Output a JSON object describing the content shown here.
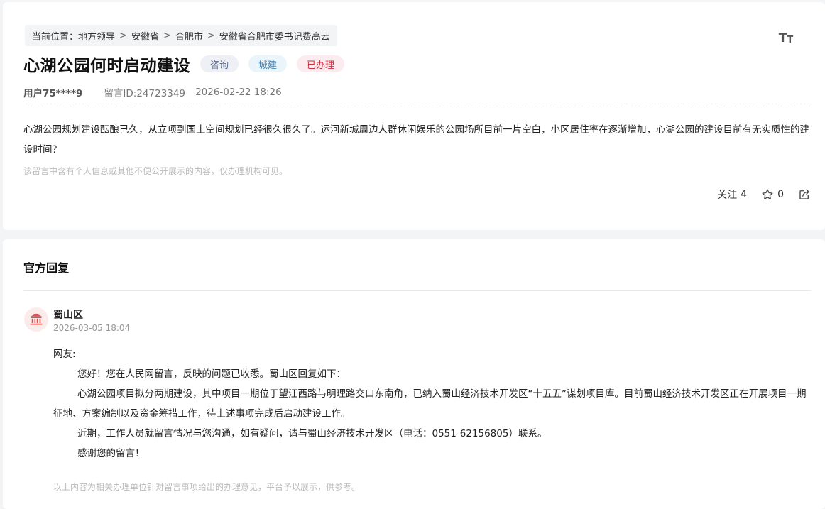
{
  "breadcrumb": {
    "prefix": "当前位置：",
    "items": [
      "地方领导",
      "安徽省",
      "合肥市",
      "安徽省合肥市委书记费高云"
    ],
    "separator": ">"
  },
  "font_size_toggle": {
    "big": "T",
    "small": "T"
  },
  "post": {
    "title": "心湖公园何时启动建设",
    "tags": [
      "咨询",
      "城建",
      "已办理"
    ],
    "user": "用户75****9",
    "message_id": "留言ID:24723349",
    "datetime": "2026-02-22 18:26",
    "content": "心湖公园规划建设酝酿已久，从立项到国土空间规划已经很久很久了。运河新城周边人群休闲娱乐的公园场所目前一片空白，小区居住率在逐渐增加，心湖公园的建设目前有无实质性的建设时间？",
    "privacy_note": "该留言中含有个人信息或其他不便公开展示的内容，仅办理机构可见。",
    "follow_label": "关注",
    "follow_count": "4",
    "star_count": "0"
  },
  "reply": {
    "heading": "官方回复",
    "org_name": "蜀山区",
    "datetime": "2026-03-05 18:04",
    "greeting": "网友:",
    "paragraphs": [
      "您好！您在人民网留言，反映的问题已收悉。蜀山区回复如下：",
      "心湖公园项目拟分两期建设，其中项目一期位于望江西路与明理路交口东南角，已纳入蜀山经济技术开发区“十五五”谋划项目库。目前蜀山经济技术开发区正在开展项目一期征地、方案编制以及资金筹措工作，待上述事项完成后启动建设工作。",
      "近期，工作人员就留言情况与您沟通，如有疑问，请与蜀山经济技术开发区（电话：0551-62156805）联系。",
      "感谢您的留言！"
    ],
    "footer_note": "以上内容为相关办理单位针对留言事项给出的办理意见，平台予以展示，供参考。"
  },
  "colors": {
    "tag_done": "#c9303f",
    "tag_city": "#3f7fb0",
    "tag_consult": "#5a6b8a",
    "org_icon": "#d9534f"
  },
  "icons": [
    "font-size-icon",
    "star-icon",
    "share-icon",
    "government-building-icon"
  ]
}
